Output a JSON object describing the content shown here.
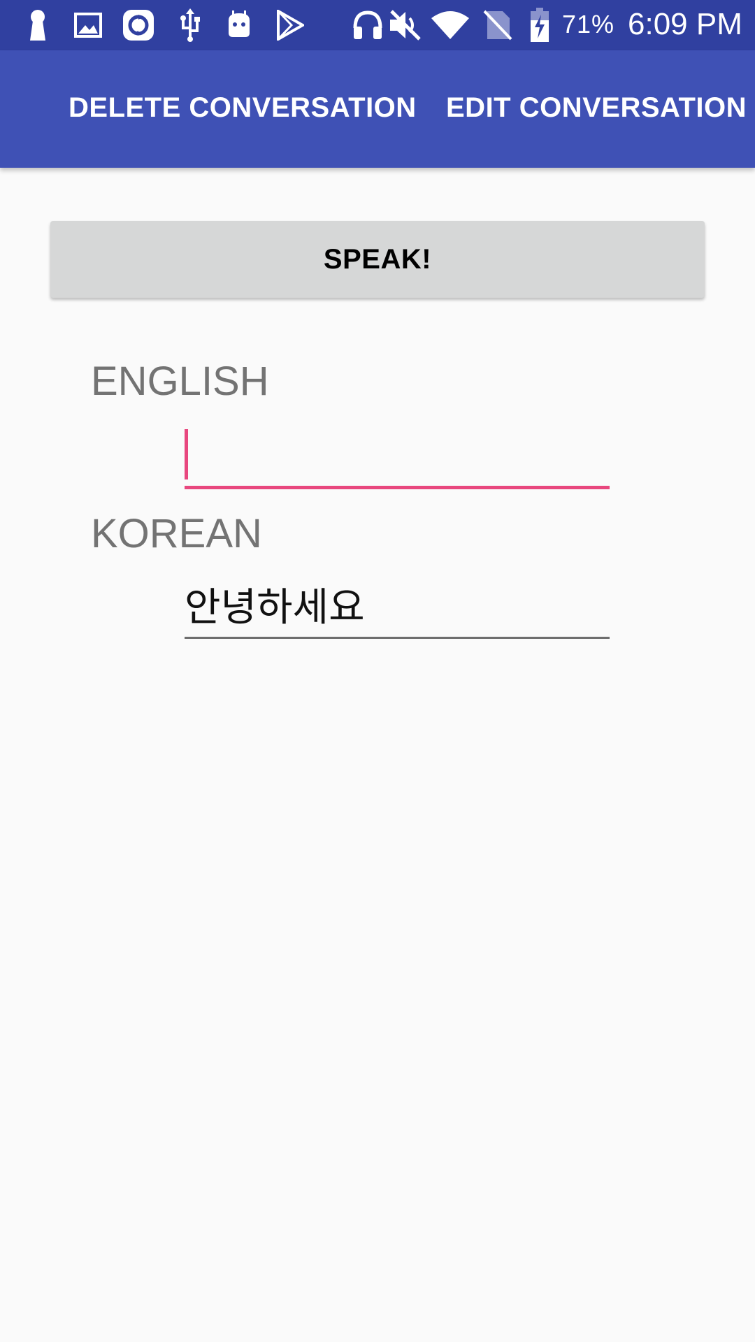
{
  "status_bar": {
    "icons": [
      "keyhole-icon",
      "image-icon",
      "sync-icon",
      "usb-icon",
      "android-icon",
      "play-store-icon",
      "headphones-icon",
      "mute-icon",
      "wifi-icon",
      "no-sim-icon",
      "battery-charging-icon"
    ],
    "battery_percent": "71%",
    "time": "6:09 PM",
    "background_color": "#3040a0"
  },
  "app_bar": {
    "delete_label": "DELETE CONVERSATION",
    "edit_label": "EDIT CONVERSATION",
    "background_color": "#3f51b5"
  },
  "speak_button": {
    "label": "SPEAK!"
  },
  "english": {
    "label": "ENGLISH",
    "value": ""
  },
  "korean": {
    "label": "KOREAN",
    "value": "안녕하세요"
  },
  "colors": {
    "accent": "#e8477e",
    "label_gray": "#737373"
  }
}
